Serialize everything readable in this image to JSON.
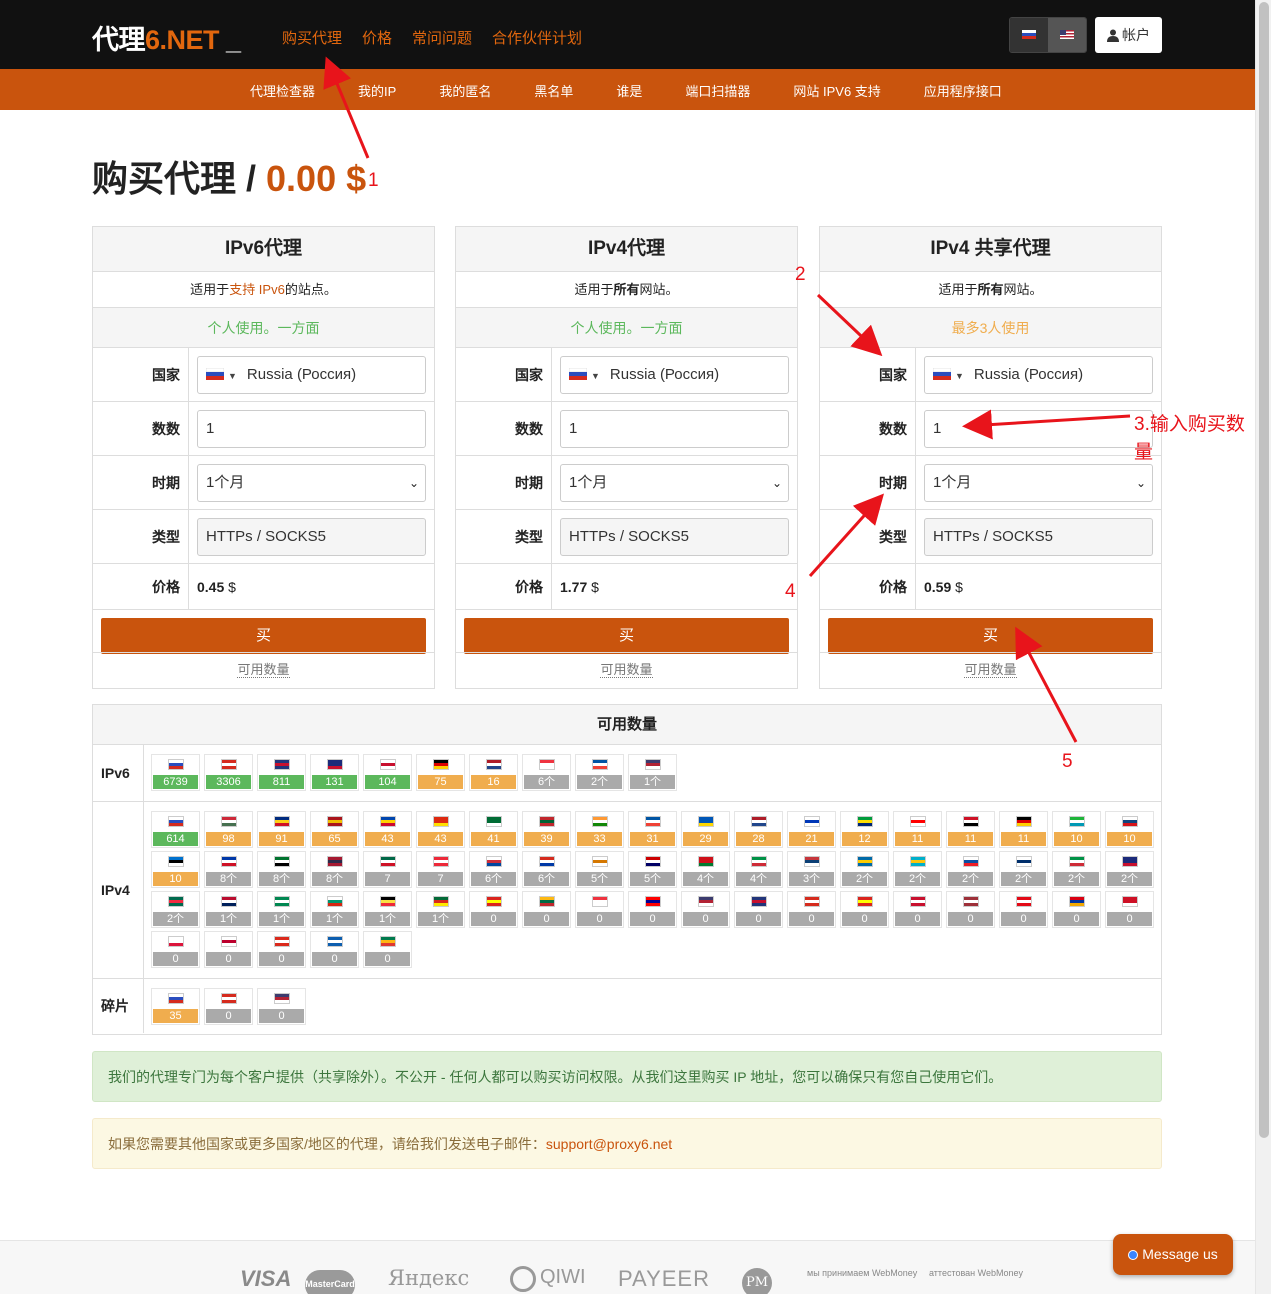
{
  "brand": {
    "main": "代理",
    "accent": "6.NET",
    "cursor": "_"
  },
  "nav": [
    "购买代理",
    "价格",
    "常问问题",
    "合作伙伴计划"
  ],
  "account_label": "帐户",
  "subnav": [
    "代理检查器",
    "我的IP",
    "我的匿名",
    "黑名单",
    "谁是",
    "端口扫描器",
    "网站 IPV6 支持",
    "应用程序接口"
  ],
  "page_title": {
    "text": "购买代理",
    "sep": " / ",
    "price": "0.00 $"
  },
  "labels": {
    "country": "国家",
    "quantity": "数数",
    "period": "时期",
    "type": "类型",
    "price": "价格",
    "buy": "买",
    "available": "可用数量"
  },
  "cards": [
    {
      "title": "IPv6代理",
      "desc_pre": "适用于",
      "desc_hl": "支持 IPv6",
      "desc_post": "的站点。",
      "usage": "个人使用。一方面",
      "country": "Russia (Россия)",
      "quantity": "1",
      "period": "1个月",
      "type": "HTTPs / SOCKS5",
      "price": "0.45",
      "currency": " $"
    },
    {
      "title": "IPv4代理",
      "desc_pre": "适用于",
      "desc_hl": "所有",
      "desc_post": "网站。",
      "usage": "个人使用。一方面",
      "country": "Russia (Россия)",
      "quantity": "1",
      "period": "1个月",
      "type": "HTTPs / SOCKS5",
      "price": "1.77",
      "currency": " $"
    },
    {
      "title": "IPv4 共享代理",
      "desc_pre": "适用于",
      "desc_hl": "所有",
      "desc_post": "网站。",
      "usage": "最多3人使用",
      "country": "Russia (Россия)",
      "quantity": "1",
      "period": "1个月",
      "type": "HTTPs / SOCKS5",
      "price": "0.59",
      "currency": " $"
    }
  ],
  "stock": {
    "title": "可用数量",
    "rows": [
      {
        "label": "IPv6",
        "items": [
          {
            "f": [
              "#fff",
              "#2a4dbf",
              "#d52b1e"
            ],
            "c": "6739",
            "s": "g"
          },
          {
            "f": [
              "#d52b1e",
              "#fff",
              "#d52b1e"
            ],
            "c": "3306",
            "s": "g"
          },
          {
            "f": [
              "#22357a",
              "#c8102e",
              "#22357a"
            ],
            "c": "811",
            "s": "g"
          },
          {
            "f": [
              "#1b2a7a",
              "#1b2a7a",
              "#c8102e"
            ],
            "c": "131",
            "s": "g"
          },
          {
            "f": [
              "#fff",
              "#c8102e",
              "#fff"
            ],
            "c": "104",
            "s": "g"
          },
          {
            "f": [
              "#000",
              "#dd0000",
              "#ffce00"
            ],
            "c": "75",
            "s": "o"
          },
          {
            "f": [
              "#ae1c28",
              "#fff",
              "#21468b"
            ],
            "c": "16",
            "s": "o"
          },
          {
            "f": [
              "#ef3340",
              "#fff",
              "#fff"
            ],
            "c": "6个",
            "s": "x"
          },
          {
            "f": [
              "#0055a4",
              "#fff",
              "#ef4135"
            ],
            "c": "2个",
            "s": "x"
          },
          {
            "f": [
              "#3c3b6e",
              "#b22234",
              "#fff"
            ],
            "c": "1个",
            "s": "x"
          }
        ]
      },
      {
        "label": "IPv4",
        "items": [
          {
            "f": [
              "#fff",
              "#2a4dbf",
              "#d52b1e"
            ],
            "c": "614",
            "s": "g"
          },
          {
            "f": [
              "#ce2939",
              "#fff",
              "#477050"
            ],
            "c": "98",
            "s": "o"
          },
          {
            "f": [
              "#002b7f",
              "#fcd116",
              "#ce1126"
            ],
            "c": "91",
            "s": "o"
          },
          {
            "f": [
              "#aa151b",
              "#f1bf00",
              "#aa151b"
            ],
            "c": "65",
            "s": "o"
          },
          {
            "f": [
              "#0046ae",
              "#ffd200",
              "#cc092f"
            ],
            "c": "43",
            "s": "o"
          },
          {
            "f": [
              "#de2910",
              "#de2910",
              "#ffde00"
            ],
            "c": "43",
            "s": "o"
          },
          {
            "f": [
              "#006c35",
              "#006c35",
              "#fff"
            ],
            "c": "41",
            "s": "o"
          },
          {
            "f": [
              "#c1272d",
              "#006233",
              "#c1272d"
            ],
            "c": "39",
            "s": "o"
          },
          {
            "f": [
              "#ff9933",
              "#fff",
              "#138808"
            ],
            "c": "33",
            "s": "o"
          },
          {
            "f": [
              "#0055a4",
              "#fff",
              "#ef4135"
            ],
            "c": "31",
            "s": "o"
          },
          {
            "f": [
              "#0057b7",
              "#0057b7",
              "#ffd700"
            ],
            "c": "29",
            "s": "o"
          },
          {
            "f": [
              "#ae1c28",
              "#fff",
              "#21468b"
            ],
            "c": "28",
            "s": "o"
          },
          {
            "f": [
              "#fff",
              "#0038b8",
              "#fff"
            ],
            "c": "21",
            "s": "o"
          },
          {
            "f": [
              "#009c3b",
              "#ffdf00",
              "#002776"
            ],
            "c": "12",
            "s": "o"
          },
          {
            "f": [
              "#fff",
              "#ff0000",
              "#fff"
            ],
            "c": "11",
            "s": "o"
          },
          {
            "f": [
              "#ce1126",
              "#fff",
              "#000"
            ],
            "c": "11",
            "s": "o"
          },
          {
            "f": [
              "#000",
              "#dd0000",
              "#ffce00"
            ],
            "c": "11",
            "s": "o"
          },
          {
            "f": [
              "#1eb53a",
              "#fff",
              "#0099b5"
            ],
            "c": "10",
            "s": "o"
          },
          {
            "f": [
              "#fff",
              "#11457e",
              "#d7141a"
            ],
            "c": "10",
            "s": "o"
          },
          {
            "f": [
              "#0072ce",
              "#000",
              "#fff"
            ],
            "c": "10",
            "s": "o"
          },
          {
            "f": [
              "#0038a8",
              "#fff",
              "#ce1126"
            ],
            "c": "8个",
            "s": "x"
          },
          {
            "f": [
              "#00732f",
              "#fff",
              "#000"
            ],
            "c": "8个",
            "s": "x"
          },
          {
            "f": [
              "#a51931",
              "#2d2a4a",
              "#a51931"
            ],
            "c": "8个",
            "s": "x"
          },
          {
            "f": [
              "#006847",
              "#fff",
              "#ce1126"
            ],
            "c": "7",
            "s": "x"
          },
          {
            "f": [
              "#ed2939",
              "#fff",
              "#ed2939"
            ],
            "c": "7",
            "s": "x"
          },
          {
            "f": [
              "#fff",
              "#cd2e3a",
              "#0047a0"
            ],
            "c": "6个",
            "s": "x"
          },
          {
            "f": [
              "#d52b1e",
              "#fff",
              "#0039a6"
            ],
            "c": "6个",
            "s": "x"
          },
          {
            "f": [
              "#fff",
              "#d57800",
              "#fff"
            ],
            "c": "5个",
            "s": "x"
          },
          {
            "f": [
              "#cc0001",
              "#fff",
              "#010066"
            ],
            "c": "5个",
            "s": "x"
          },
          {
            "f": [
              "#cf101a",
              "#cf101a",
              "#007c30"
            ],
            "c": "4个",
            "s": "x"
          },
          {
            "f": [
              "#009246",
              "#fff",
              "#ce2b37"
            ],
            "c": "4个",
            "s": "x"
          },
          {
            "f": [
              "#c6363c",
              "#0c4076",
              "#fff"
            ],
            "c": "3个",
            "s": "x"
          },
          {
            "f": [
              "#006aa7",
              "#fecc00",
              "#006aa7"
            ],
            "c": "2个",
            "s": "x"
          },
          {
            "f": [
              "#00afca",
              "#fec50c",
              "#00afca"
            ],
            "c": "2个",
            "s": "x"
          },
          {
            "f": [
              "#fff",
              "#0b4ea2",
              "#ee1c25"
            ],
            "c": "2个",
            "s": "x"
          },
          {
            "f": [
              "#fff",
              "#002f6c",
              "#fff"
            ],
            "c": "2个",
            "s": "x"
          },
          {
            "f": [
              "#009246",
              "#fff",
              "#ce2b37"
            ],
            "c": "2个",
            "s": "x"
          },
          {
            "f": [
              "#1b2a7a",
              "#1b2a7a",
              "#c8102e"
            ],
            "c": "2个",
            "s": "x"
          },
          {
            "f": [
              "#006a4e",
              "#f42a41",
              "#006a4e"
            ],
            "c": "2个",
            "s": "x"
          },
          {
            "f": [
              "#ba0c2f",
              "#fff",
              "#00205b"
            ],
            "c": "1个",
            "s": "x"
          },
          {
            "f": [
              "#008751",
              "#fff",
              "#008751"
            ],
            "c": "1个",
            "s": "x"
          },
          {
            "f": [
              "#fff",
              "#00966e",
              "#d62612"
            ],
            "c": "1个",
            "s": "x"
          },
          {
            "f": [
              "#000",
              "#fae042",
              "#ed2939"
            ],
            "c": "1个",
            "s": "x"
          },
          {
            "f": [
              "#046a38",
              "#da291c",
              "#ffe900"
            ],
            "c": "1个",
            "s": "x"
          },
          {
            "f": [
              "#da251d",
              "#ffff00",
              "#da251d"
            ],
            "c": "0",
            "s": "x"
          },
          {
            "f": [
              "#fdb913",
              "#006a44",
              "#c1272d"
            ],
            "c": "0",
            "s": "x"
          },
          {
            "f": [
              "#ef3340",
              "#fff",
              "#fff"
            ],
            "c": "0",
            "s": "x"
          },
          {
            "f": [
              "#fe0000",
              "#000095",
              "#fe0000"
            ],
            "c": "0",
            "s": "x"
          },
          {
            "f": [
              "#3c3b6e",
              "#b22234",
              "#fff"
            ],
            "c": "0",
            "s": "x"
          },
          {
            "f": [
              "#22357a",
              "#c8102e",
              "#22357a"
            ],
            "c": "0",
            "s": "x"
          },
          {
            "f": [
              "#d52b1e",
              "#fff",
              "#d52b1e"
            ],
            "c": "0",
            "s": "x"
          },
          {
            "f": [
              "#da251d",
              "#ffff00",
              "#da251d"
            ],
            "c": "0",
            "s": "x"
          },
          {
            "f": [
              "#c8102e",
              "#fff",
              "#c8102e"
            ],
            "c": "0",
            "s": "x"
          },
          {
            "f": [
              "#9e3039",
              "#fff",
              "#9e3039"
            ],
            "c": "0",
            "s": "x"
          },
          {
            "f": [
              "#e30a17",
              "#fff",
              "#e30a17"
            ],
            "c": "0",
            "s": "x"
          },
          {
            "f": [
              "#d90012",
              "#0033a0",
              "#f2a800"
            ],
            "c": "0",
            "s": "x"
          },
          {
            "f": [
              "#ce1126",
              "#ce1126",
              "#fff"
            ],
            "c": "0",
            "s": "x"
          },
          {
            "f": [
              "#fff",
              "#fff",
              "#dc143c"
            ],
            "c": "0",
            "s": "x"
          },
          {
            "f": [
              "#fff",
              "#bc002d",
              "#fff"
            ],
            "c": "0",
            "s": "x"
          },
          {
            "f": [
              "#da291c",
              "#fff",
              "#da291c"
            ],
            "c": "0",
            "s": "x"
          },
          {
            "f": [
              "#0d5eaf",
              "#fff",
              "#0d5eaf"
            ],
            "c": "0",
            "s": "x"
          },
          {
            "f": [
              "#007a4d",
              "#ffb612",
              "#de3831"
            ],
            "c": "0",
            "s": "x"
          }
        ]
      },
      {
        "label": "碎片",
        "items": [
          {
            "f": [
              "#fff",
              "#2a4dbf",
              "#d52b1e"
            ],
            "c": "35",
            "s": "o"
          },
          {
            "f": [
              "#d52b1e",
              "#fff",
              "#d52b1e"
            ],
            "c": "0",
            "s": "x"
          },
          {
            "f": [
              "#3c3b6e",
              "#b22234",
              "#fff"
            ],
            "c": "0",
            "s": "x"
          }
        ]
      }
    ]
  },
  "info_text": "我们的代理专门为每个客户提供（共享除外）。不公开 - 任何人都可以购买访问权限。从我们这里购买 IP 地址，您可以确保只有您自己使用它们。",
  "contact_text": "如果您需要其他国家或更多国家/地区的代理，请给我们发送电子邮件：",
  "contact_email": "support@proxy6.net",
  "payments": [
    "VISA",
    "MasterCard",
    "Яндекс",
    "QIWI",
    "PAYEER",
    "PM",
    "мы принимаем WebMoney",
    "аттестован WebMoney"
  ],
  "chat_label": "Message us",
  "annotations": [
    "1",
    "2",
    "3.输入购买数",
    "量",
    "4",
    "5"
  ],
  "colors": {
    "accent": "#c9540d",
    "annotation": "#e8141b",
    "success": "#5cb85c",
    "warning": "#f0ad4e",
    "muted": "#aaaaaa"
  }
}
